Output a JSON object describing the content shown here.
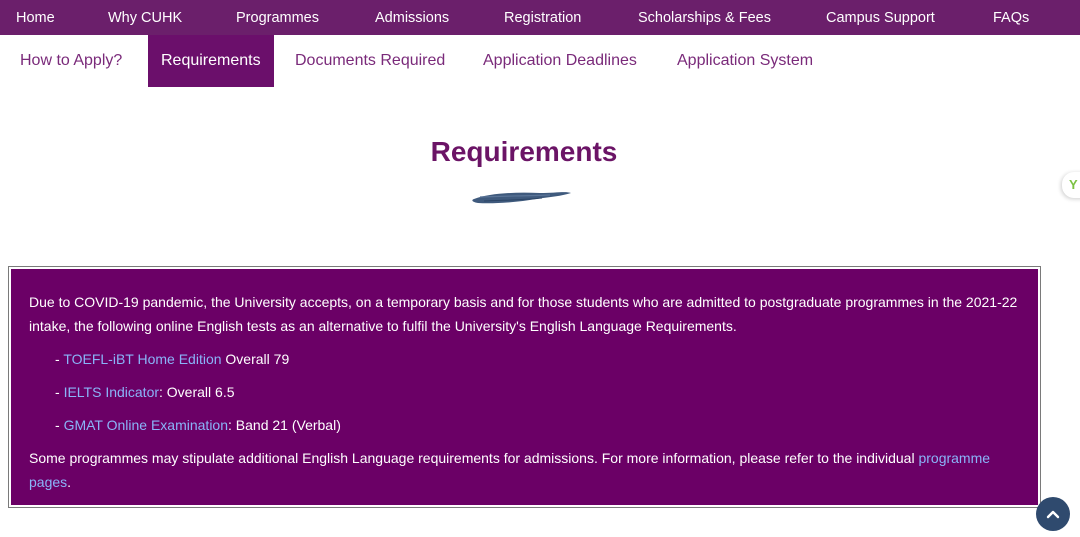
{
  "topnav": {
    "items": [
      "Home",
      "Why CUHK",
      "Programmes",
      "Admissions",
      "Registration",
      "Scholarships & Fees",
      "Campus Support",
      "FAQs"
    ]
  },
  "subnav": {
    "items": [
      "How to Apply?",
      "Requirements",
      "Documents Required",
      "Application Deadlines",
      "Application System"
    ],
    "active": "Requirements"
  },
  "page": {
    "title": "Requirements"
  },
  "notice": {
    "intro": "Due to COVID-19 pandemic, the University accepts, on a temporary basis and for those students who are admitted to postgraduate programmes in the 2021-22 intake, the following online English tests as an alternative to fulfil the University's English Language Requirements.",
    "tests": [
      {
        "prefix": "- ",
        "name": "TOEFL-iBT Home Edition",
        "separator": " ",
        "score": "Overall 79"
      },
      {
        "prefix": "- ",
        "name": "IELTS Indicator",
        "separator": ": ",
        "score": "Overall 6.5"
      },
      {
        "prefix": "- ",
        "name": "GMAT Online Examination",
        "separator": ": ",
        "score": "Band 21 (Verbal)"
      }
    ],
    "outro_text": "Some programmes may stipulate additional English Language requirements for admissions. For more information, please refer to the individual ",
    "outro_link": "programme pages",
    "outro_end": "."
  },
  "side_tab": {
    "label": "Y"
  },
  "colors": {
    "nav_bg": "#6b1f6b",
    "active_tab": "#6b0f6b",
    "box_bg": "#6b0066",
    "link": "#8ab4f8",
    "scroll_btn": "#2f4a6e"
  },
  "icons": {
    "brush": "brush-stroke-divider-icon",
    "scroll_top": "chevron-up-icon"
  }
}
